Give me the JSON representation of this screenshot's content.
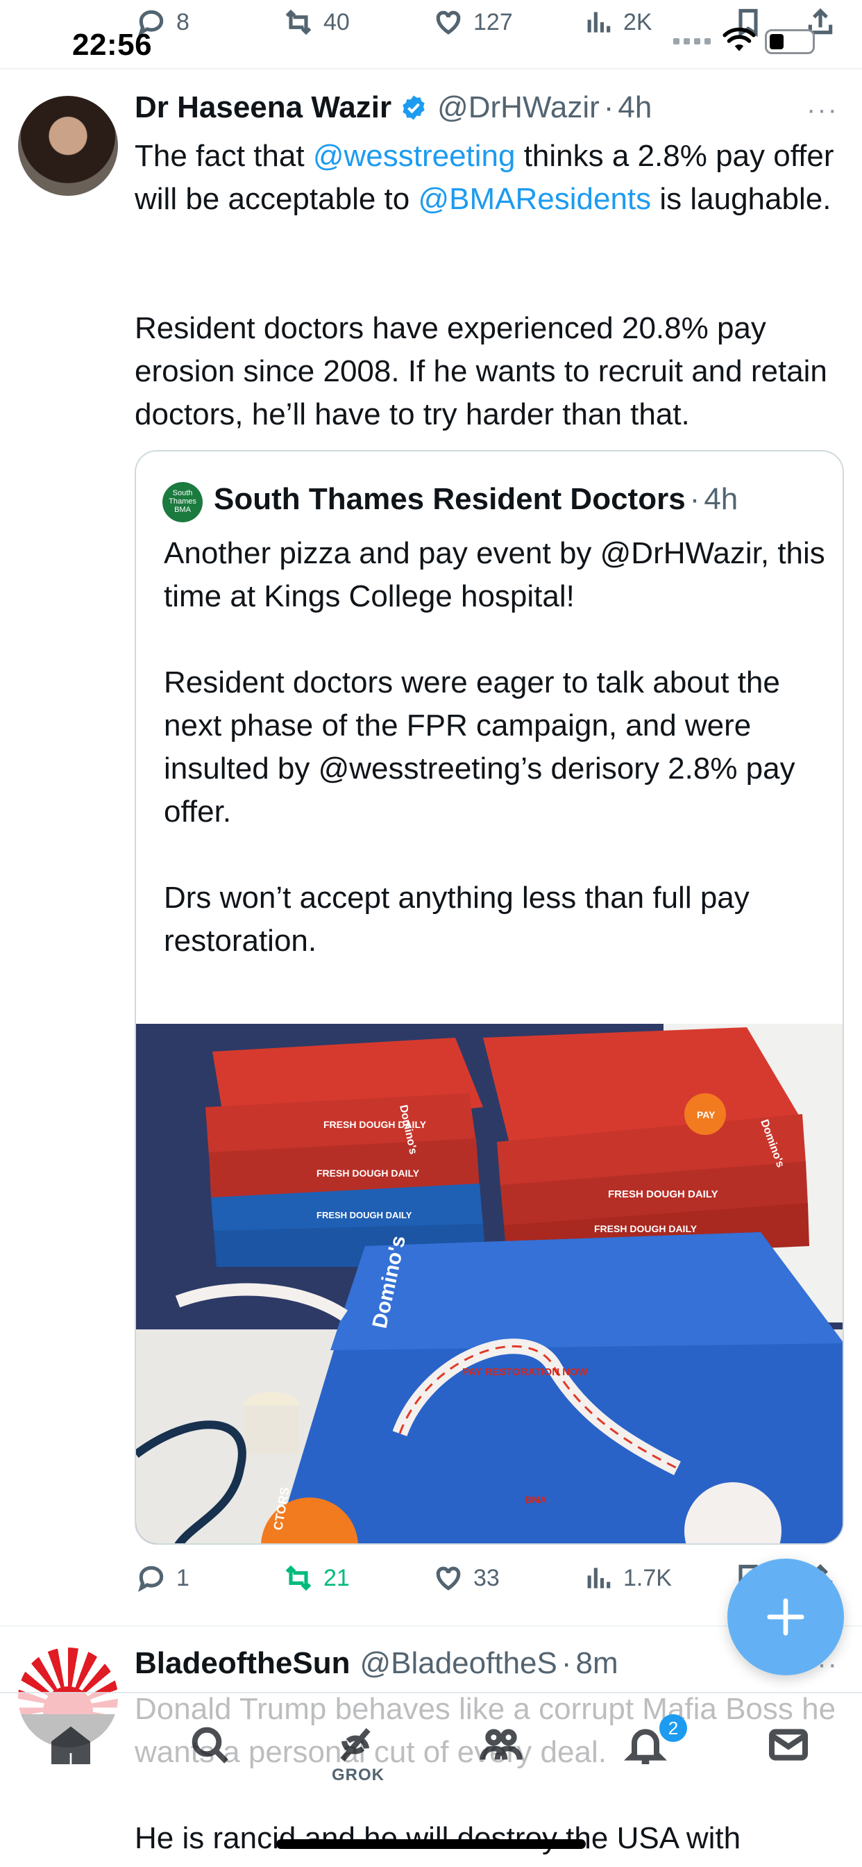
{
  "status_bar": {
    "time": "22:56"
  },
  "previous_tweet_actions": {
    "replies": "8",
    "reposts": "40",
    "likes": "127",
    "views": "2K"
  },
  "tweet": {
    "author_name": "Dr Haseena Wazir",
    "handle": "@DrHWazir",
    "separator": "·",
    "time": "4h",
    "text_part1": "The fact that ",
    "mention1": "@wesstreeting",
    "text_part2": " thinks a 2.8% pay offer will be acceptable to ",
    "mention2": "@BMAResidents",
    "text_part3": " is laughable.",
    "paragraph2": "Resident doctors have experienced 20.8% pay erosion since 2008. If he wants to recruit and retain doctors, he’ll have to try harder than that.",
    "more_label": "···",
    "quoted": {
      "author_name": "South Thames Resident Doctors",
      "avatar_text": "South Thames BMA",
      "time": "4h",
      "text": "Another pizza and pay event by @DrHWazir, this time at Kings College hospital!\n\nResident doctors were eager to talk about the next phase of the FPR campaign, and were insulted by @wesstreeting’s derisory 2.8% pay offer.\n\nDrs won’t accept anything less than full pay restoration.",
      "photo_texts": {
        "box_label": "FRESH DOUGH DAILY",
        "brand": "Domino's",
        "lanyard": "PAY RESTORATION NOW",
        "badge": "PAY",
        "doctors_badge": "CTORS",
        "bma": "BMA"
      }
    },
    "actions": {
      "replies": "1",
      "reposts": "21",
      "likes": "33",
      "views": "1.7K"
    }
  },
  "next_tweet": {
    "author_name": "BladeoftheSun",
    "handle": "@BladeoftheS",
    "time": "8m",
    "text": "Donald Trump behaves like a corrupt Mafia Boss he wants a personal cut of every deal.\n\nHe is rancid and he will destroy the USA with",
    "more_label": "···"
  },
  "tab_bar": {
    "grok_label": "GROK",
    "notifications_badge": "2"
  },
  "colors": {
    "accent": "#1d9bf0",
    "repost_active": "#00ba7c",
    "text_secondary": "#536471",
    "fab": "#63b1f4"
  }
}
